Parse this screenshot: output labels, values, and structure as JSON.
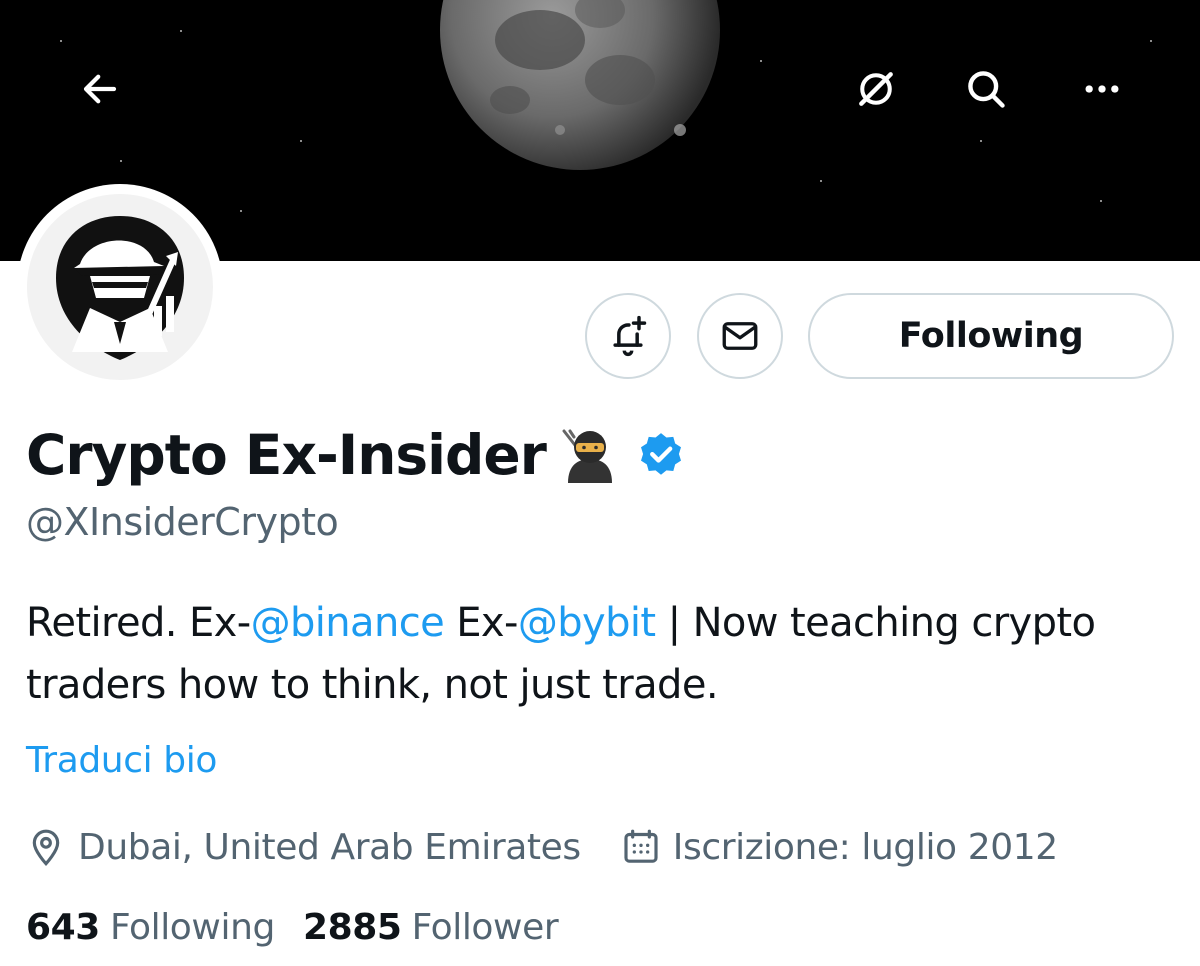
{
  "header": {
    "back_icon": "arrow-left-icon",
    "grok_icon": "grok-slash-icon",
    "search_icon": "search-icon",
    "more_icon": "more-dots-icon"
  },
  "actions": {
    "notify_icon": "bell-plus-icon",
    "message_icon": "envelope-icon",
    "following_label": "Following"
  },
  "profile": {
    "display_name": "Crypto Ex-Insider",
    "name_emoji": "ninja-emoji",
    "verified_icon": "verified-badge-icon",
    "handle": "@XInsiderCrypto",
    "bio": {
      "part1": "Retired. Ex-",
      "mention1": "@binance",
      "part2": " Ex-",
      "mention2": "@bybit",
      "part3": " | Now teaching crypto traders how to think, not just trade."
    },
    "translate_label": "Traduci bio",
    "location": "Dubai, United Arab Emirates",
    "joined": "Iscrizione: luglio 2012"
  },
  "stats": {
    "following_count": "643",
    "following_label": "Following",
    "followers_count": "2885",
    "followers_label": "Follower"
  },
  "colors": {
    "accent": "#1d9bf0",
    "text": "#0f1419",
    "secondary": "#536471",
    "border": "#cfd9de"
  }
}
